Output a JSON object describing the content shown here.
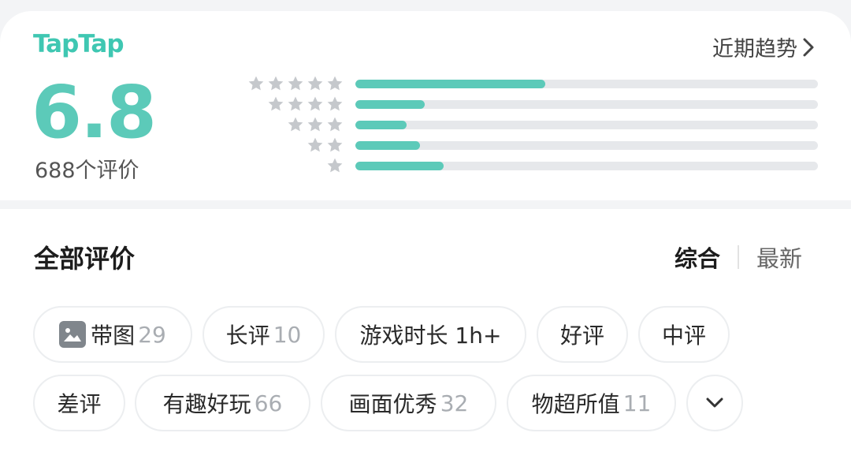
{
  "brand": {
    "logo_text": "TapTap",
    "accent_color": "#5ccab9"
  },
  "rating": {
    "score": "6.8",
    "review_count": "688个评价",
    "trend_label": "近期趋势",
    "distribution": [
      {
        "stars": 5,
        "fraction": 0.41
      },
      {
        "stars": 4,
        "fraction": 0.15
      },
      {
        "stars": 3,
        "fraction": 0.11
      },
      {
        "stars": 2,
        "fraction": 0.14
      },
      {
        "stars": 1,
        "fraction": 0.19
      }
    ]
  },
  "reviews": {
    "title": "全部评价",
    "sort": {
      "active": "综合",
      "other": "最新"
    }
  },
  "filters": [
    {
      "label": "带图",
      "count": "29",
      "icon": "image-icon"
    },
    {
      "label": "长评",
      "count": "10"
    },
    {
      "label": "游戏时长 1h+",
      "count": ""
    },
    {
      "label": "好评",
      "count": ""
    },
    {
      "label": "中评",
      "count": ""
    },
    {
      "label": "差评",
      "count": ""
    },
    {
      "label": "有趣好玩",
      "count": "66"
    },
    {
      "label": "画面优秀",
      "count": "32"
    },
    {
      "label": "物超所值",
      "count": "11"
    }
  ]
}
